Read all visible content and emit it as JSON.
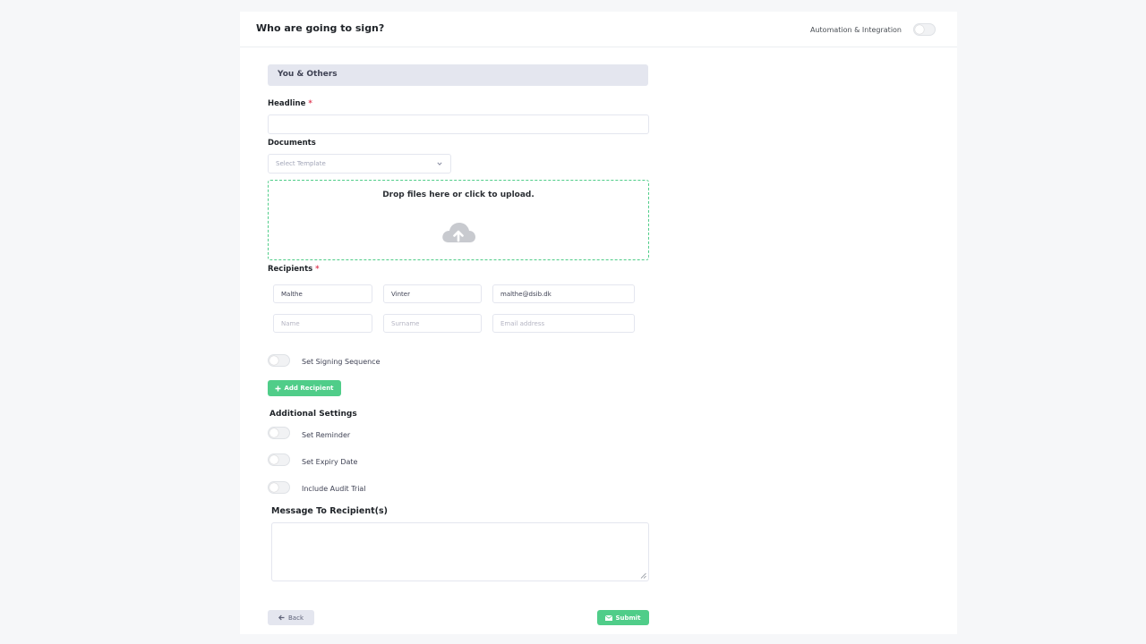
{
  "header": {
    "title": "Who are going to sign?",
    "automation_label": "Automation & Integration"
  },
  "section": {
    "title": "You & Others"
  },
  "headline": {
    "label": "Headline",
    "required_mark": "*",
    "value": "",
    "placeholder": ""
  },
  "documents": {
    "label": "Documents",
    "select_placeholder": "Select Template",
    "dropzone_text": "Drop files here or click to upload."
  },
  "recipients": {
    "label": "Recipients",
    "required_mark": "*",
    "rows": [
      {
        "name": "Malthe",
        "surname": "Vinter",
        "email": "malthe@dsib.dk"
      },
      {
        "name": "",
        "surname": "",
        "email": ""
      }
    ],
    "placeholders": {
      "name": "Name",
      "surname": "Surname",
      "email": "Email address"
    }
  },
  "signing_sequence": {
    "label": "Set Signing Sequence"
  },
  "add_recipient": {
    "label": "Add Recipient"
  },
  "additional_settings": {
    "title": "Additional Settings",
    "reminder_label": "Set Reminder",
    "expiry_label": "Set Expiry Date",
    "audit_label": "Include Audit Trial"
  },
  "message": {
    "label": "Message To Recipient(s)",
    "value": ""
  },
  "footer": {
    "back_label": "Back",
    "submit_label": "Submit"
  },
  "colors": {
    "accent_green": "#50cd89",
    "required_red": "#e0415a",
    "section_bg": "#e4e6ef"
  },
  "icons": [
    "chevron-down-icon",
    "cloud-upload-icon",
    "plus-icon",
    "arrow-left-icon",
    "envelope-icon",
    "resize-grip-icon"
  ]
}
